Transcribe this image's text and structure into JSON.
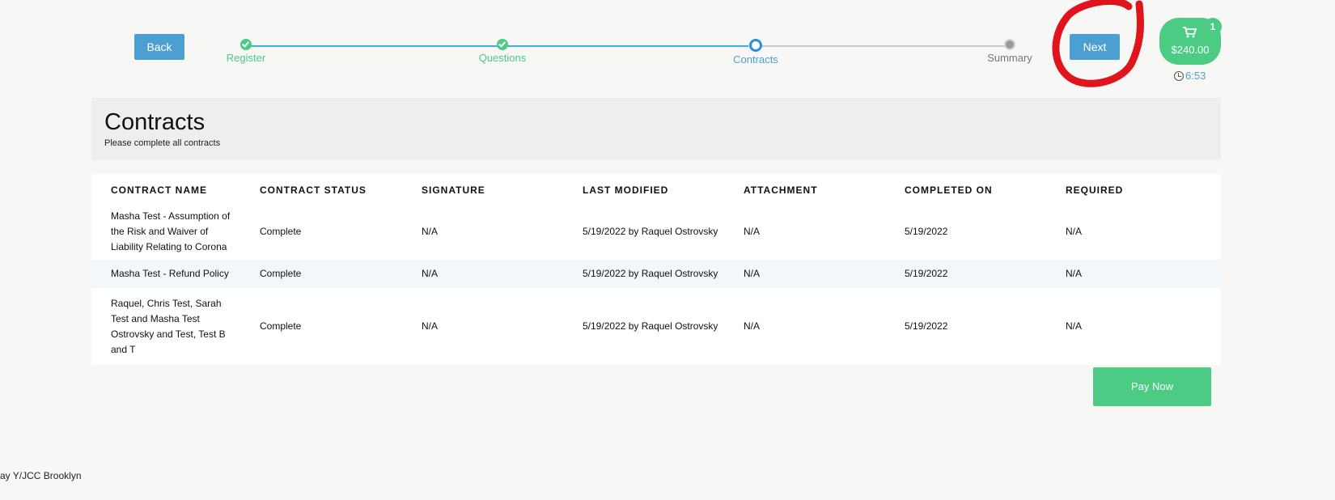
{
  "nav": {
    "back_label": "Back",
    "next_label": "Next"
  },
  "stepper": {
    "steps": [
      {
        "label": "Register",
        "state": "done"
      },
      {
        "label": "Questions",
        "state": "done"
      },
      {
        "label": "Contracts",
        "state": "current"
      },
      {
        "label": "Summary",
        "state": "todo"
      }
    ]
  },
  "cart": {
    "count": "1",
    "total": "$240.00",
    "icon": "cart-icon"
  },
  "timer": {
    "value": "6:53",
    "icon": "clock-icon"
  },
  "header": {
    "title": "Contracts",
    "subtitle": "Please complete all contracts"
  },
  "table": {
    "columns": [
      "CONTRACT NAME",
      "CONTRACT STATUS",
      "SIGNATURE",
      "LAST MODIFIED",
      "ATTACHMENT",
      "COMPLETED ON",
      "REQUIRED"
    ],
    "rows": [
      {
        "name_lines": [
          "Masha Test - Assumption of",
          "the Risk and Waiver of",
          "Liability Relating to Corona"
        ],
        "status": "Complete",
        "signature": "N/A",
        "last_modified": "5/19/2022 by Raquel Ostrovsky",
        "attachment": "N/A",
        "completed_on": "5/19/2022",
        "required": "N/A"
      },
      {
        "name_lines": [
          "Masha Test - Refund Policy"
        ],
        "status": "Complete",
        "signature": "N/A",
        "last_modified": "5/19/2022 by Raquel Ostrovsky",
        "attachment": "N/A",
        "completed_on": "5/19/2022",
        "required": "N/A"
      },
      {
        "name_lines": [
          "Raquel, Chris Test, Sarah",
          "Test and Masha Test",
          "Ostrovsky and Test, Test B",
          "and T"
        ],
        "status": "Complete",
        "signature": "N/A",
        "last_modified": "5/19/2022 by Raquel Ostrovsky",
        "attachment": "N/A",
        "completed_on": "5/19/2022",
        "required": "N/A"
      }
    ]
  },
  "pay_now_label": "Pay Now",
  "footer_text": "Bay Y/JCC Brooklyn",
  "colors": {
    "accent_blue": "#4e9fd1",
    "accent_green": "#4ccb84",
    "annotation_red": "#e0141c"
  }
}
